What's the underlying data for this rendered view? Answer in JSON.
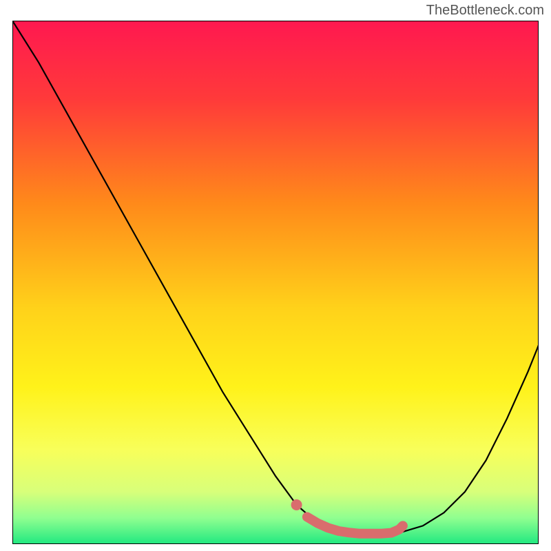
{
  "attribution": "TheBottleneck.com",
  "chart_data": {
    "type": "line",
    "title": "",
    "xlabel": "",
    "ylabel": "",
    "xlim": [
      0,
      100
    ],
    "ylim": [
      0,
      100
    ],
    "series": [
      {
        "name": "bottleneck-curve",
        "x": [
          0,
          5,
          10,
          15,
          20,
          25,
          30,
          35,
          40,
          45,
          50,
          54,
          58,
          62,
          66,
          70,
          74,
          78,
          82,
          86,
          90,
          94,
          98,
          100
        ],
        "y": [
          100,
          92,
          83,
          74,
          65,
          56,
          47,
          38,
          29,
          21,
          13,
          7.5,
          4,
          2.5,
          2,
          2,
          2.3,
          3.5,
          6,
          10,
          16,
          24,
          33,
          38
        ]
      }
    ],
    "highlight_segment": {
      "name": "optimal-range",
      "color": "#d96d6d",
      "x": [
        56,
        58,
        60,
        62,
        64,
        66,
        68,
        70,
        72,
        73.5,
        74.2
      ],
      "y": [
        5.2,
        4,
        3.1,
        2.5,
        2.2,
        2,
        2,
        2,
        2.15,
        2.8,
        3.5
      ]
    },
    "highlight_dot": {
      "x": 54,
      "y": 7.5,
      "color": "#d96d6d"
    },
    "gradient_background": {
      "stops": [
        {
          "offset": 0.0,
          "color": "#ff1850"
        },
        {
          "offset": 0.15,
          "color": "#ff3a3a"
        },
        {
          "offset": 0.35,
          "color": "#ff8a1a"
        },
        {
          "offset": 0.55,
          "color": "#ffd21a"
        },
        {
          "offset": 0.7,
          "color": "#fff21a"
        },
        {
          "offset": 0.82,
          "color": "#f8ff5a"
        },
        {
          "offset": 0.9,
          "color": "#d8ff7a"
        },
        {
          "offset": 0.95,
          "color": "#90ff90"
        },
        {
          "offset": 1.0,
          "color": "#20e880"
        }
      ]
    },
    "axes_visible": false
  }
}
